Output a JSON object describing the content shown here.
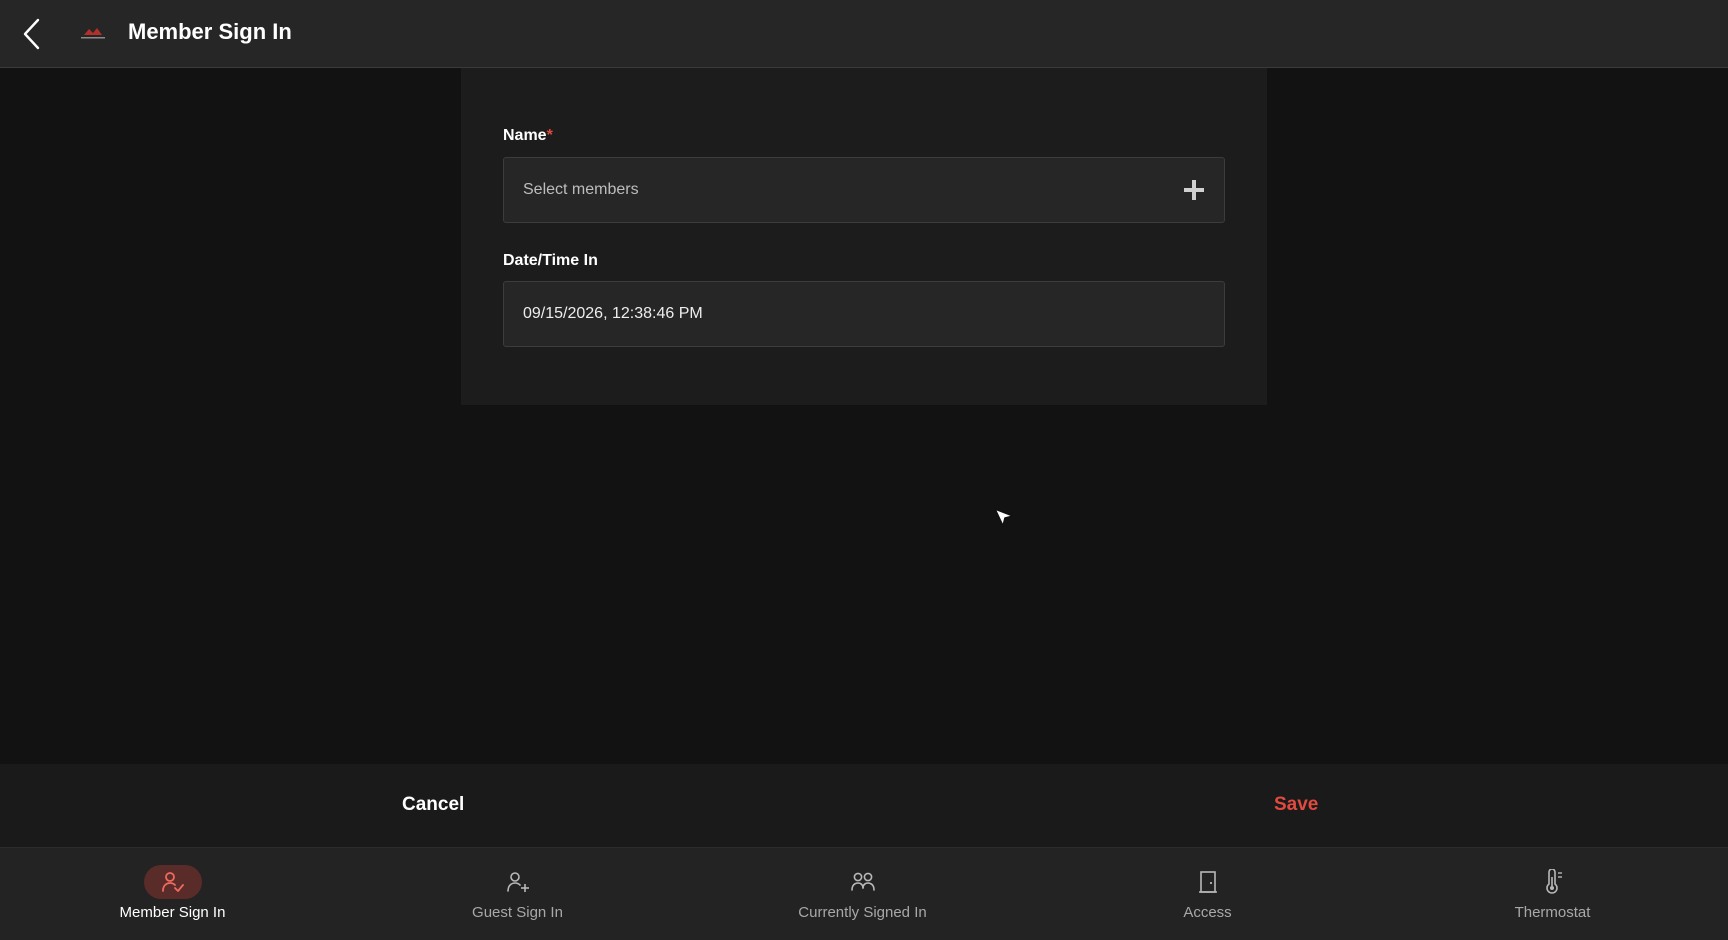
{
  "header": {
    "title": "Member Sign In",
    "back_icon": "chevron-left-icon",
    "logo": "club-logo"
  },
  "form": {
    "name_label": "Name",
    "name_required_mark": "*",
    "name_placeholder": "Select members",
    "name_add_icon": "plus-icon",
    "datetime_label": "Date/Time In",
    "datetime_value": "09/15/2026, 12:38:46 PM"
  },
  "actions": {
    "cancel_label": "Cancel",
    "save_label": "Save"
  },
  "tabs": [
    {
      "label": "Member Sign In",
      "icon": "person-check-icon",
      "active": true
    },
    {
      "label": "Guest Sign In",
      "icon": "person-add-icon",
      "active": false
    },
    {
      "label": "Currently Signed In",
      "icon": "people-icon",
      "active": false
    },
    {
      "label": "Access",
      "icon": "door-icon",
      "active": false
    },
    {
      "label": "Thermostat",
      "icon": "thermometer-icon",
      "active": false
    }
  ],
  "colors": {
    "accent": "#e04a3f",
    "header_bg": "#262626",
    "page_bg": "#121212",
    "card_bg": "#1c1c1c"
  }
}
